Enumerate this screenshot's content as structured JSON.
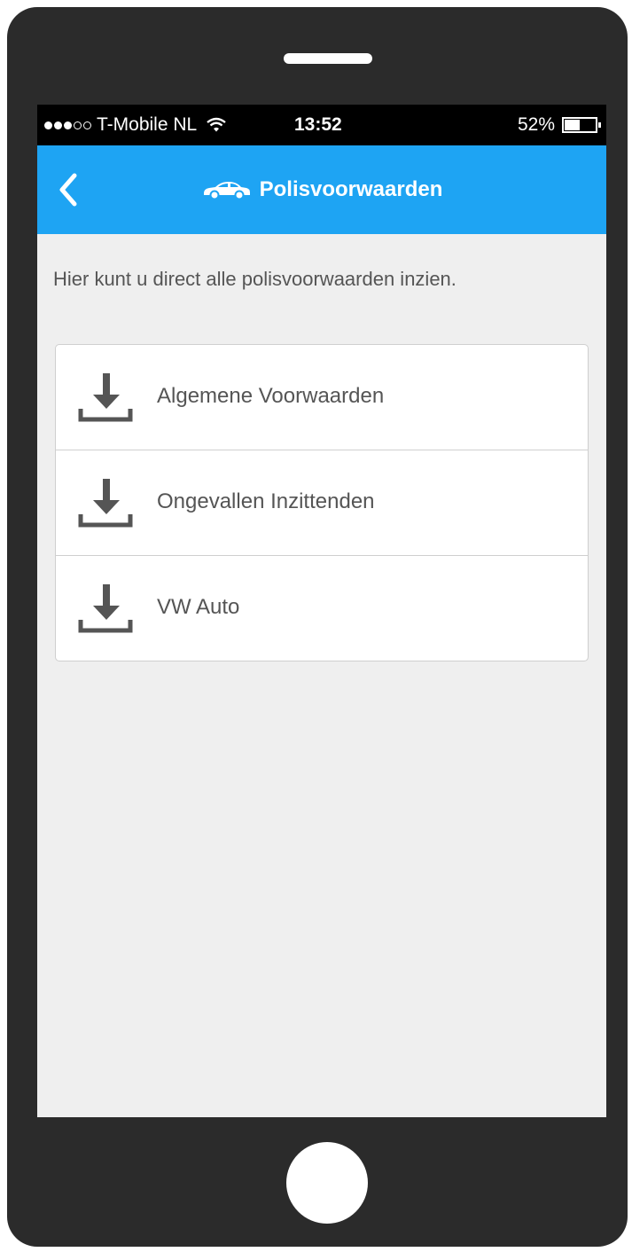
{
  "status_bar": {
    "carrier": "T-Mobile NL",
    "time": "13:52",
    "battery_percent": "52%",
    "battery_level": 0.52,
    "signal_bars_filled": 3,
    "signal_bars_total": 5
  },
  "navbar": {
    "title": "Polisvoorwaarden",
    "back_icon": "chevron-left-icon",
    "title_icon": "car-icon",
    "color": "#1ea4f3"
  },
  "intro_text": "Hier kunt u direct alle polisvoorwaarden inzien.",
  "documents": [
    {
      "label": "Algemene Voorwaarden",
      "icon": "download-icon"
    },
    {
      "label": "Ongevallen Inzittenden",
      "icon": "download-icon"
    },
    {
      "label": "VW Auto",
      "icon": "download-icon"
    }
  ]
}
